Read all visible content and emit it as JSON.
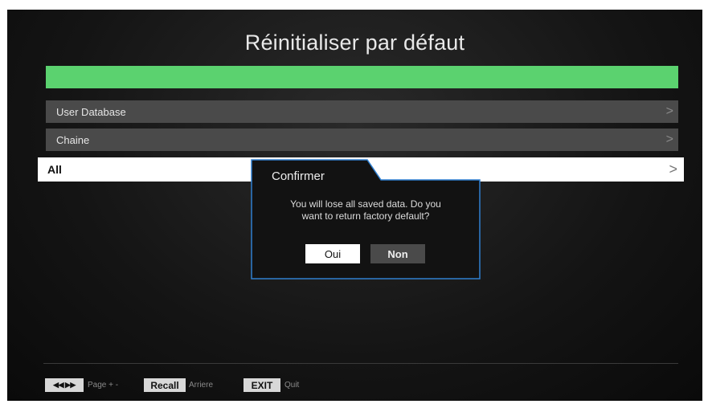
{
  "screen": {
    "title": "Réinitialiser par défaut"
  },
  "menu": {
    "items": [
      {
        "label": "User Database",
        "chevron": ">"
      },
      {
        "label": "Chaine",
        "chevron": ">"
      },
      {
        "label": "All",
        "chevron": ">",
        "selected": true
      }
    ]
  },
  "dialog": {
    "title": "Confirmer",
    "message_line1": "You will lose all saved data. Do you",
    "message_line2": "want to return factory default?",
    "yes_label": "Oui",
    "no_label": "Non",
    "border_color": "#2f7fd0"
  },
  "footer": {
    "page_key": "◀◀ ▶▶",
    "page_label": "Page + -",
    "recall_key": "Recall",
    "recall_label": "Arriere",
    "exit_key": "EXIT",
    "exit_label": "Quit"
  },
  "colors": {
    "accent_green": "#5bd26f",
    "item_bg": "#4a4a4a",
    "selected_bg": "#ffffff"
  }
}
